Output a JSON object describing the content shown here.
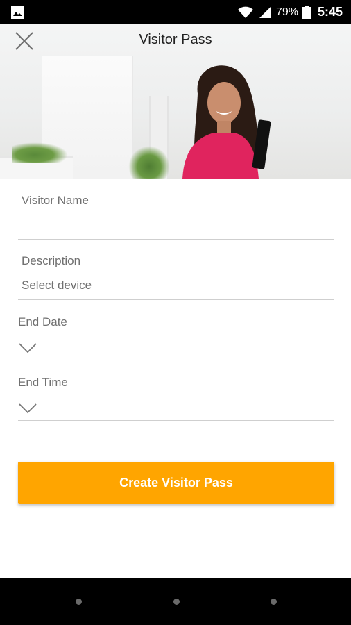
{
  "status_bar": {
    "battery_percent": "79%",
    "time": "5:45",
    "icons": [
      "gallery-icon",
      "wifi-icon",
      "signal-icon",
      "battery-icon"
    ]
  },
  "header": {
    "title": "Visitor Pass",
    "close_icon": "close-icon"
  },
  "form": {
    "visitor_name_label": "Visitor Name",
    "visitor_name_value": "",
    "description_label": "Description",
    "description_value": "Select device",
    "end_date_label": "End Date",
    "end_time_label": "End Time",
    "dropdown_icon": "chevron-down-icon"
  },
  "actions": {
    "create_label": "Create Visitor Pass"
  },
  "colors": {
    "accent": "#ffa500",
    "label": "#707070",
    "divider": "#cfcfcf"
  },
  "nav_bar": {
    "buttons": [
      "back-button",
      "home-button",
      "recents-button"
    ]
  }
}
